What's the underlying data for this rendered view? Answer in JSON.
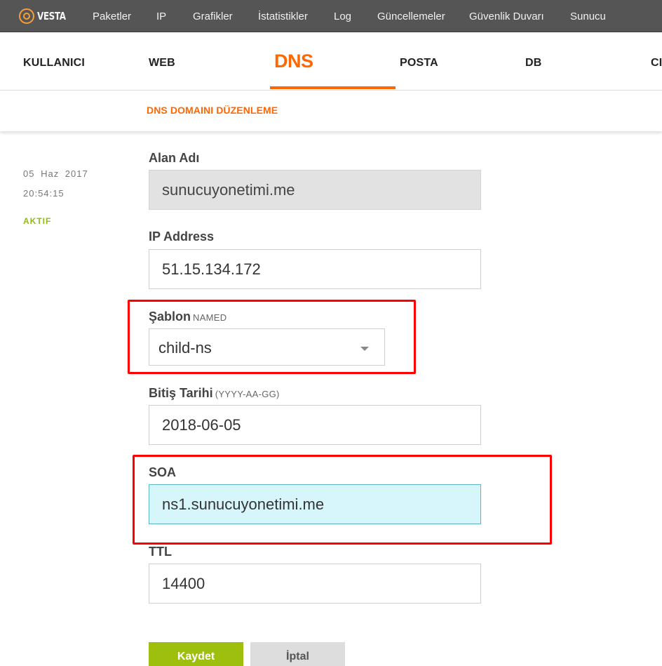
{
  "app": {
    "logo_text": "VESTA"
  },
  "topnav": [
    "Paketler",
    "IP",
    "Grafikler",
    "İstatistikler",
    "Log",
    "Güncellemeler",
    "Güvenlik Duvarı",
    "Sunucu"
  ],
  "tabs": [
    "KULLANICI",
    "WEB",
    "DNS",
    "POSTA",
    "DB",
    "CI"
  ],
  "active_tab": "DNS",
  "page": {
    "subtitle": "DNS DOMAINI DÜZENLEME"
  },
  "meta": {
    "date": "05 Haz 2017",
    "time": "20:54:15",
    "status": "AKTIF"
  },
  "form": {
    "domain": {
      "label": "Alan Adı",
      "value": "sunucuyonetimi.me"
    },
    "ip": {
      "label": "IP Address",
      "value": "51.15.134.172"
    },
    "template": {
      "label": "Şablon",
      "hint": "NAMED",
      "value": "child-ns"
    },
    "expiry": {
      "label": "Bitiş Tarihi",
      "hint": "(YYYY-AA-GG)",
      "value": "2018-06-05"
    },
    "soa": {
      "label": "SOA",
      "value": "ns1.sunucuyonetimi.me"
    },
    "ttl": {
      "label": "TTL",
      "value": "14400"
    }
  },
  "buttons": {
    "save": "Kaydet",
    "cancel": "İptal"
  },
  "colors": {
    "accent": "#ff6701",
    "topbar": "#555555",
    "save": "#9fbf0f",
    "status": "#8fbb1c",
    "highlight": "#ff0000"
  }
}
